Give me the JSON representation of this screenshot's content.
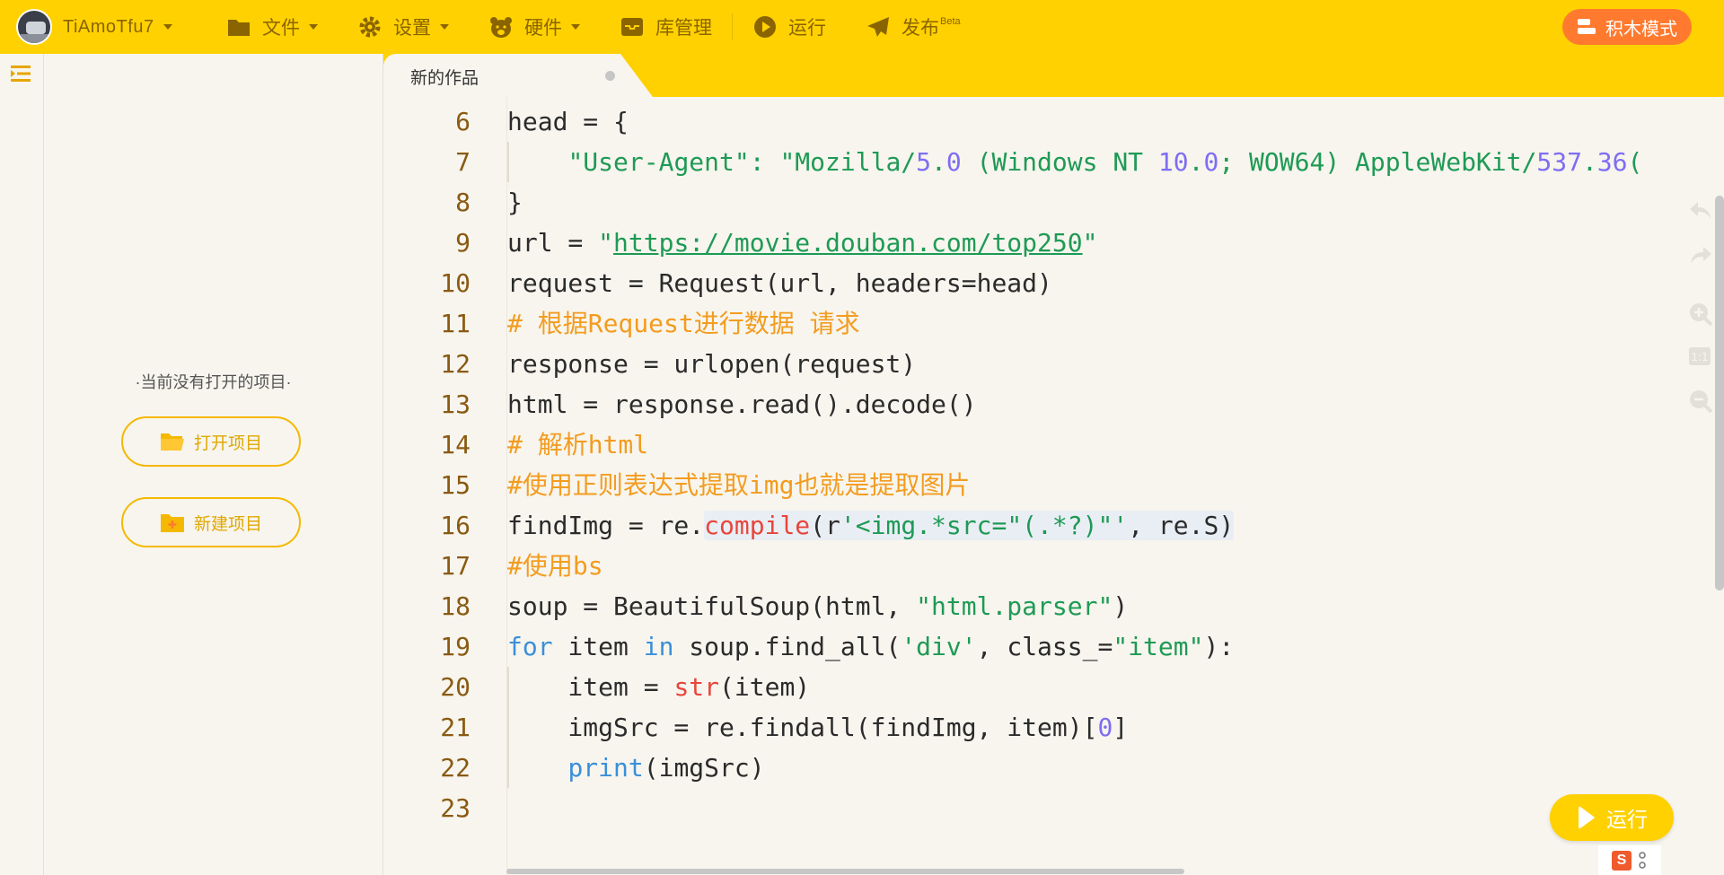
{
  "topbar": {
    "user_name": "TiAmoTfu7",
    "menu": {
      "file": "文件",
      "settings": "设置",
      "hardware": "硬件",
      "library": "库管理",
      "run": "运行",
      "publish": "发布",
      "publish_badge": "Beta"
    },
    "blocks_mode": "积木模式"
  },
  "projects_panel": {
    "empty_text": "·当前没有打开的项目·",
    "open_label": "打开项目",
    "new_label": "新建项目"
  },
  "tab": {
    "title": "新的作品"
  },
  "editor": {
    "line_numbers": [
      "6",
      "7",
      "8",
      "9",
      "10",
      "11",
      "12",
      "13",
      "14",
      "15",
      "16",
      "17",
      "18",
      "19",
      "20",
      "21",
      "22",
      "23"
    ],
    "lines": [
      "head = {",
      "    \"User-Agent\": \"Mozilla/5.0 (Windows NT 10.0; WOW64) AppleWebKit/537.36(",
      "}",
      "url = \"https://movie.douban.com/top250\"",
      "request = Request(url, headers=head)",
      "# 根据Request进行数据 请求",
      "response = urlopen(request)",
      "html = response.read().decode()",
      "# 解析html",
      "#使用正则表达式提取img也就是提取图片",
      "findImg = re.compile(r'<img.*src=\"(.*?)\"', re.S)",
      "#使用bs",
      "soup = BeautifulSoup(html, \"html.parser\")",
      "for item in soup.find_all('div', class_=\"item\"):",
      "    item = str(item)",
      "    imgSrc = re.findall(findImg, item)[0]",
      "    print(imgSrc)",
      ""
    ]
  },
  "run_button": "运行",
  "ime": {
    "icon_letter": "S"
  },
  "colors": {
    "accent_yellow": "#ffd100",
    "blocks_orange": "#ff7a2f",
    "string_green": "#1f9a55",
    "comment_orange": "#f39c1f",
    "keyword_blue": "#3b8fd9",
    "builtin_red": "#e8453c"
  },
  "icons": [
    "user-avatar",
    "folder-icon",
    "gear-icon",
    "bear-icon",
    "inbox-icon",
    "play-circle-icon",
    "paper-plane-icon",
    "blocks-icon",
    "menu-toggle-icon",
    "undo-icon",
    "redo-icon",
    "zoom-in-icon",
    "zoom-reset-icon",
    "zoom-out-icon",
    "play-icon"
  ]
}
